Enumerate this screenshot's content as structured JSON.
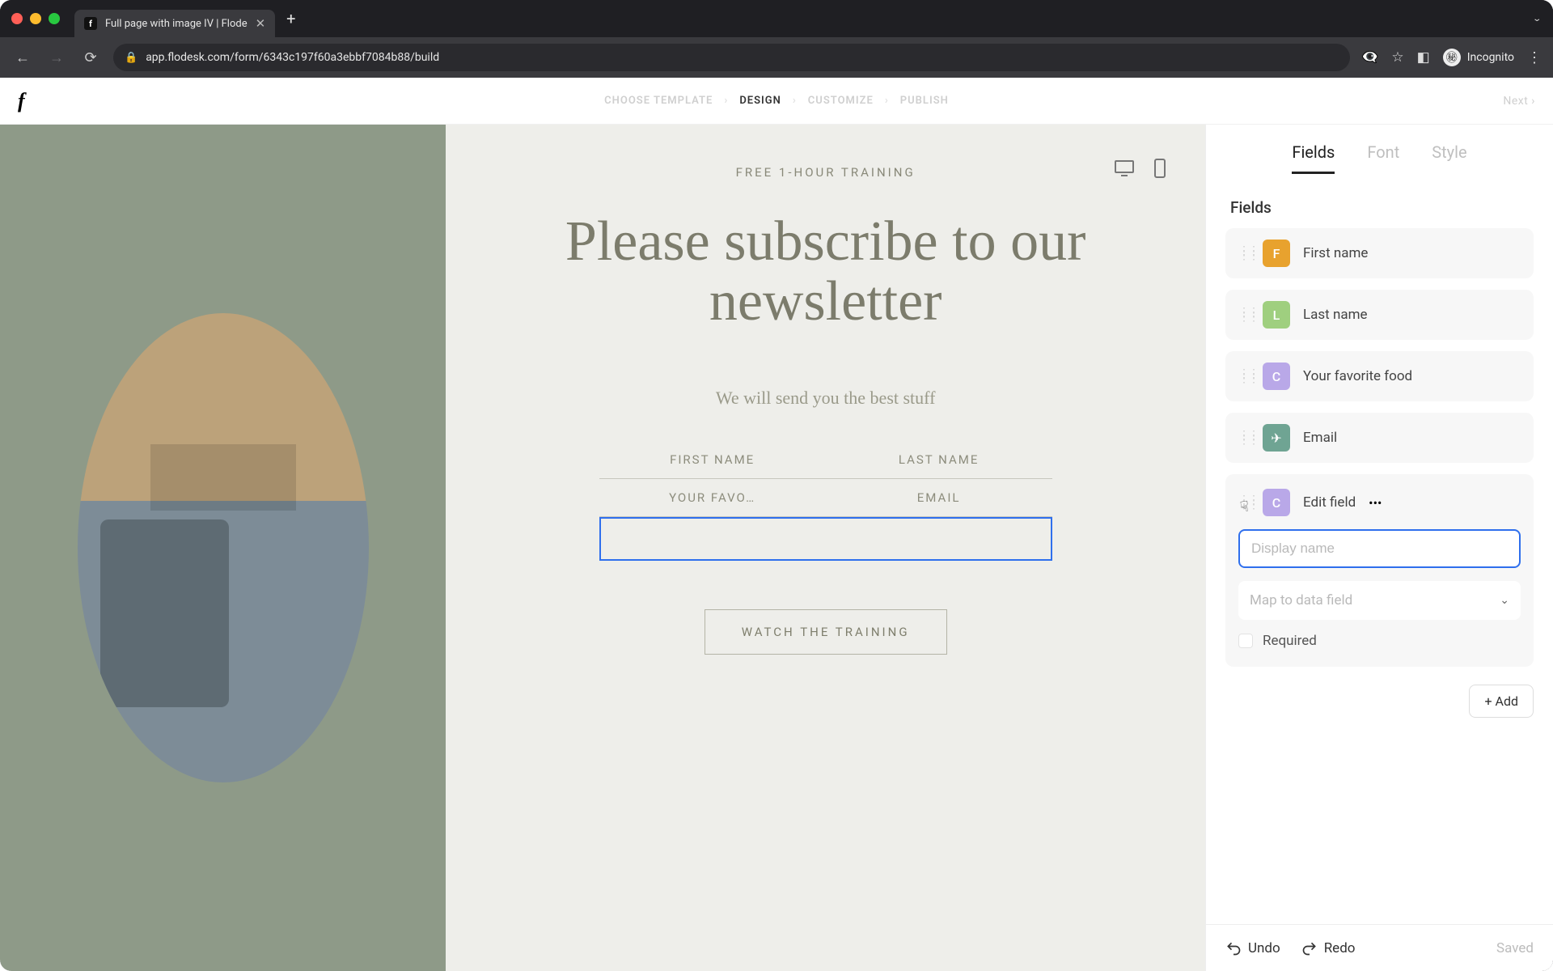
{
  "browser": {
    "tab_title": "Full page with image IV | Flode",
    "url": "app.flodesk.com/form/6343c197f60a3ebbf7084b88/build",
    "incognito_label": "Incognito"
  },
  "header": {
    "steps": [
      "CHOOSE TEMPLATE",
      "DESIGN",
      "CUSTOMIZE",
      "PUBLISH"
    ],
    "active_step_index": 1,
    "next_label": "Next  ›"
  },
  "canvas": {
    "eyebrow": "FREE 1-HOUR TRAINING",
    "hero": "Please subscribe to our newsletter",
    "sub": "We will send you the best stuff",
    "field_labels": [
      "FIRST NAME",
      "LAST NAME",
      "YOUR FAVO…",
      "EMAIL"
    ],
    "cta": "WATCH THE TRAINING"
  },
  "sidebar": {
    "tabs": [
      "Fields",
      "Font",
      "Style"
    ],
    "active_tab_index": 0,
    "panel_title": "Fields",
    "items": [
      {
        "badge": "F",
        "badge_class": "o",
        "label": "First name"
      },
      {
        "badge": "L",
        "badge_class": "g",
        "label": "Last name"
      },
      {
        "badge": "C",
        "badge_class": "p",
        "label": "Your favorite food"
      },
      {
        "badge": "✈",
        "badge_class": "t",
        "label": "Email"
      }
    ],
    "edit": {
      "badge": "C",
      "title": "Edit field",
      "display_placeholder": "Display name",
      "map_label": "Map to data field",
      "required_label": "Required",
      "more": "•••"
    },
    "add_label": "+ Add"
  },
  "footer": {
    "undo": "Undo",
    "redo": "Redo",
    "saved": "Saved"
  }
}
